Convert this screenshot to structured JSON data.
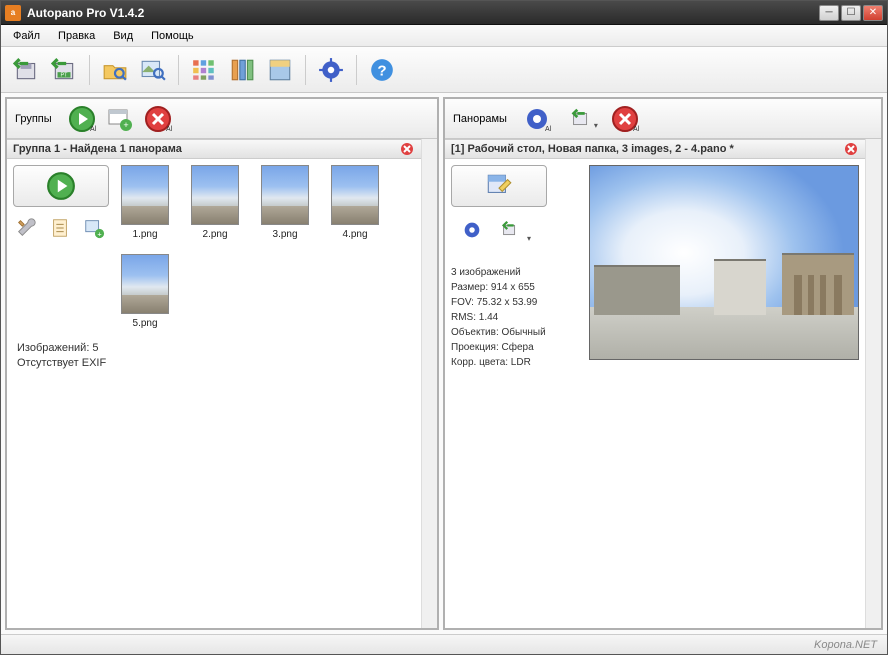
{
  "window": {
    "title": "Autopano Pro V1.4.2"
  },
  "menu": {
    "file": "Файл",
    "edit": "Правка",
    "view": "Вид",
    "help": "Помощь"
  },
  "left": {
    "header_label": "Группы",
    "group_title": "Группа 1 - Найдена 1 панорама",
    "thumbs": [
      {
        "label": "1.png"
      },
      {
        "label": "2.png"
      },
      {
        "label": "3.png"
      },
      {
        "label": "4.png"
      },
      {
        "label": "5.png"
      }
    ],
    "footer_images": "Изображений: 5",
    "footer_exif": "Отсутствует EXIF"
  },
  "right": {
    "header_label": "Панорамы",
    "pano_title": "[1] Рабочий стол, Новая папка, 3 images, 2 - 4.pano *",
    "info": {
      "images": "3 изображений",
      "size": "Размер: 914 x 655",
      "fov": "FOV: 75.32 x 53.99",
      "rms": "RMS: 1.44",
      "lens": "Объектив: Обычный",
      "proj": "Проекция: Сфера",
      "color": "Корр. цвета: LDR"
    }
  },
  "statusbar": {
    "watermark": "Kopona.NET"
  }
}
